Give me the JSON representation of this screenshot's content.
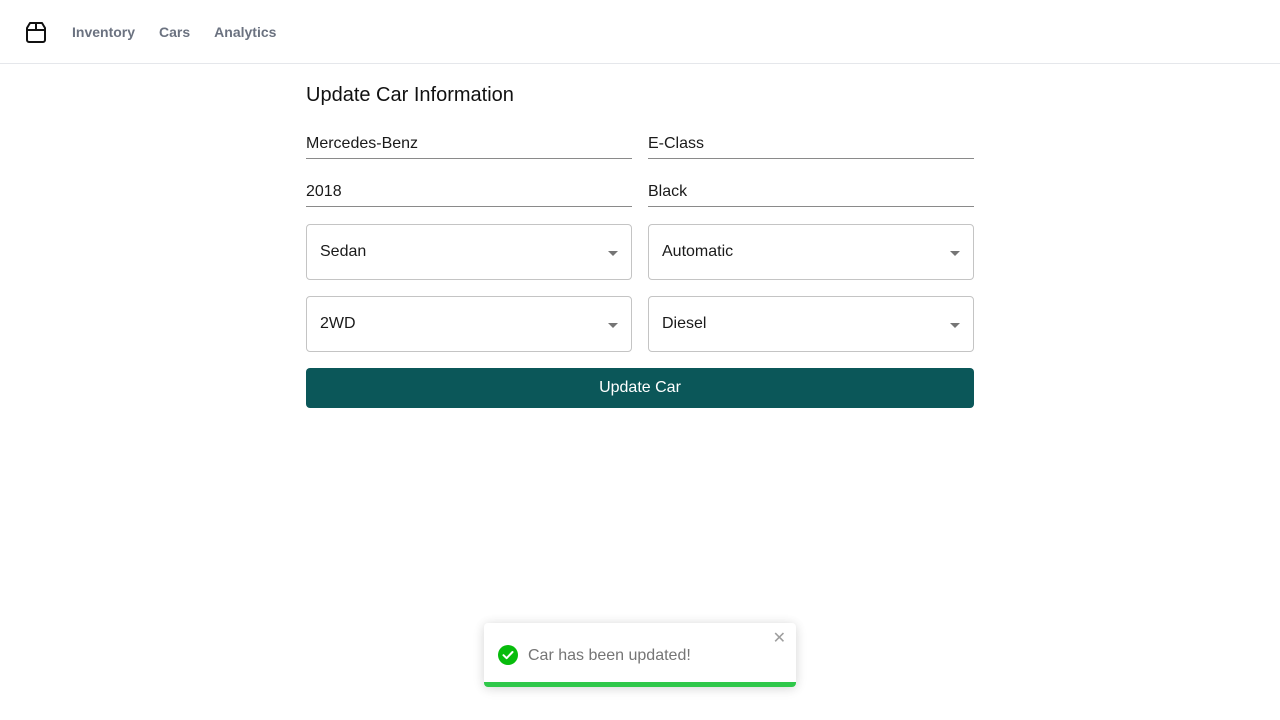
{
  "nav": {
    "logo_icon": "box-icon",
    "items": [
      {
        "label": "Inventory"
      },
      {
        "label": "Cars"
      },
      {
        "label": "Analytics"
      }
    ]
  },
  "form": {
    "title": "Update Car Information",
    "make": "Mercedes-Benz",
    "model": "E-Class",
    "year": "2018",
    "color": "Black",
    "body_type": "Sedan",
    "transmission": "Automatic",
    "drivetrain": "2WD",
    "fuel": "Diesel",
    "submit_label": "Update Car"
  },
  "toast": {
    "message": "Car has been updated!",
    "icon": "check-circle-icon",
    "close_glyph": "✕",
    "progress_fraction": 1.0,
    "color": "#2fc84a"
  },
  "colors": {
    "primary": "#0b5759",
    "success": "#2fc84a"
  }
}
